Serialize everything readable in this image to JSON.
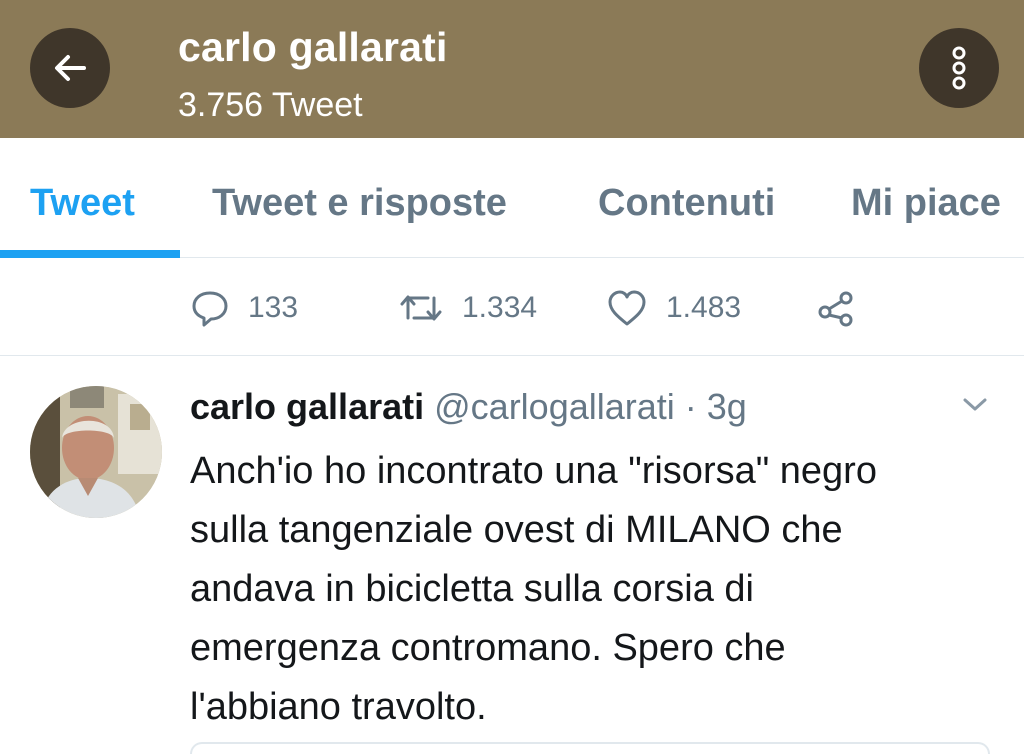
{
  "header": {
    "title": "carlo gallarati",
    "subtitle": "3.756 Tweet",
    "back_icon": "arrow-left-icon",
    "more_icon": "more-vertical-icon",
    "background_color": "#8b7a57"
  },
  "tabs": [
    {
      "label": "Tweet",
      "active": true
    },
    {
      "label": "Tweet e risposte",
      "active": false
    },
    {
      "label": "Contenuti",
      "active": false
    },
    {
      "label": "Mi piace",
      "active": false
    }
  ],
  "actions": {
    "replies": "133",
    "retweets": "1.334",
    "likes": "1.483",
    "share_icon": "share-icon"
  },
  "tweet": {
    "name": "carlo gallarati",
    "handle": "@carlogallarati",
    "separator": " · ",
    "time": "3g",
    "lines": [
      "Anch'io ho incontrato una \"risorsa\" negro",
      "sulla tangenziale ovest di MILANO che",
      "andava in bicicletta sulla corsia di",
      "emergenza contromano. Spero che",
      "l'abbiano travolto."
    ]
  },
  "colors": {
    "accent": "#1da1f2",
    "muted": "#657786"
  }
}
